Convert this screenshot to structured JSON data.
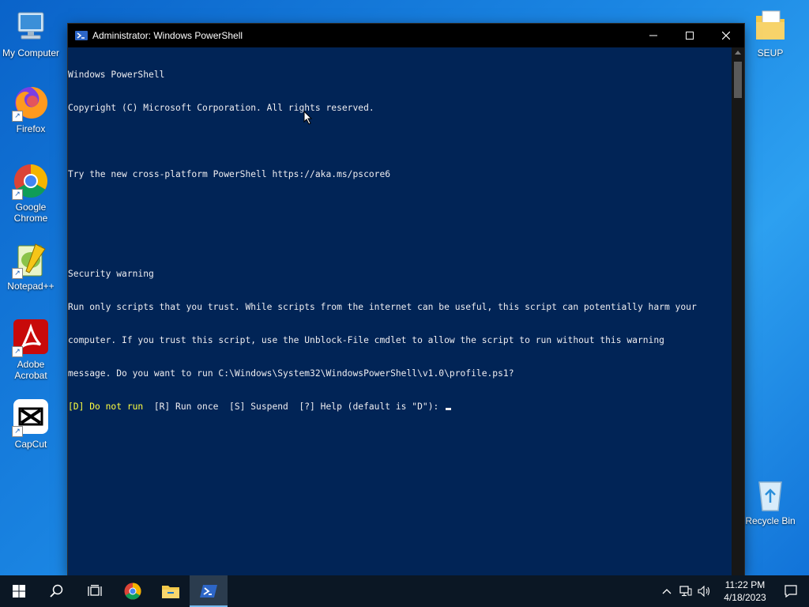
{
  "desktop": {
    "icons": [
      {
        "label": "My Computer"
      },
      {
        "label": "Firefox"
      },
      {
        "label": "Google Chrome"
      },
      {
        "label": "Notepad++"
      },
      {
        "label": "Adobe Acrobat"
      },
      {
        "label": "CapCut"
      },
      {
        "label": "SEUP"
      },
      {
        "label": "Recycle Bin"
      }
    ]
  },
  "window": {
    "title": "Administrator: Windows PowerShell",
    "console_lines": [
      "Windows PowerShell",
      "Copyright (C) Microsoft Corporation. All rights reserved.",
      "",
      "Try the new cross-platform PowerShell https://aka.ms/pscore6",
      "",
      "",
      "Security warning",
      "Run only scripts that you trust. While scripts from the internet can be useful, this script can potentially harm your",
      "computer. If you trust this script, use the Unblock-File cmdlet to allow the script to run without this warning",
      "message. Do you want to run C:\\Windows\\System32\\WindowsPowerShell\\v1.0\\profile.ps1?"
    ],
    "prompt_choice_default": "[D] Do not run",
    "prompt_rest": "  [R] Run once  [S] Suspend  [?] Help (default is \"D\"): ",
    "colors": {
      "background": "#012456",
      "text": "#eeedf0",
      "highlight": "#ffff3f"
    }
  },
  "taskbar": {
    "items": [
      "start-icon",
      "search-icon",
      "task-view-icon",
      "chrome-icon",
      "file-explorer-icon",
      "powershell-icon"
    ],
    "clock": {
      "time": "11:22 PM",
      "date": "4/18/2023"
    }
  }
}
